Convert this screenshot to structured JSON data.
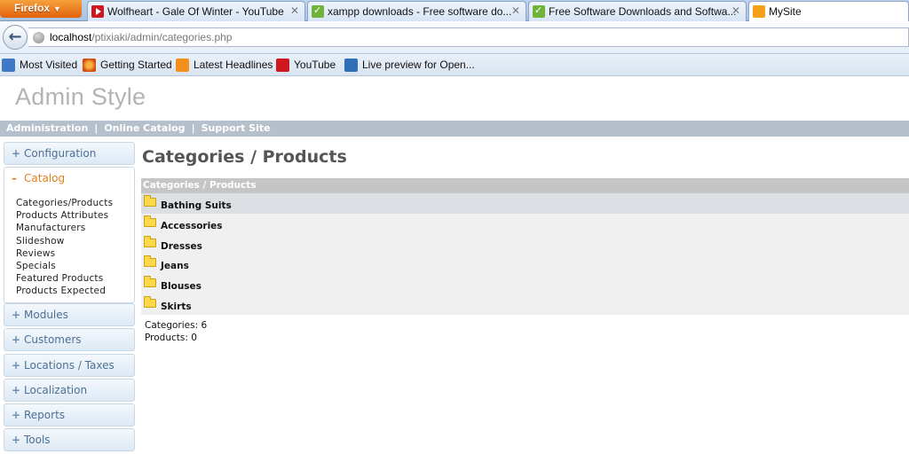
{
  "browser": {
    "app_button": "Firefox",
    "tabs": [
      {
        "title": "Wolfheart - Gale Of Winter - YouTube",
        "icon": "youtube-icon"
      },
      {
        "title": "xampp downloads - Free software do...",
        "icon": "softpedia-icon"
      },
      {
        "title": "Free Software Downloads and Softwa...",
        "icon": "softpedia-icon"
      },
      {
        "title": "MySite",
        "icon": "mysite-icon"
      }
    ],
    "url_host": "localhost",
    "url_path": "/ptixiaki/admin/categories.php",
    "bookmarks": [
      "Most Visited",
      "Getting Started",
      "Latest Headlines",
      "YouTube",
      "Live preview for Open..."
    ]
  },
  "site": {
    "title": "Admin Style",
    "top_links": [
      "Administration",
      "Online Catalog",
      "Support Site"
    ]
  },
  "sidebar": {
    "groups": [
      {
        "sign": "+",
        "label": "Configuration"
      },
      {
        "sign": "–",
        "label": "Catalog"
      },
      {
        "sign": "+",
        "label": "Modules"
      },
      {
        "sign": "+",
        "label": "Customers"
      },
      {
        "sign": "+",
        "label": "Locations / Taxes"
      },
      {
        "sign": "+",
        "label": "Localization"
      },
      {
        "sign": "+",
        "label": "Reports"
      },
      {
        "sign": "+",
        "label": "Tools"
      }
    ],
    "catalog_items": [
      "Categories/Products",
      "Products Attributes",
      "Manufacturers",
      "Slideshow",
      "Reviews",
      "Specials",
      "Featured Products",
      "Products Expected"
    ]
  },
  "main": {
    "title": "Categories / Products",
    "grid_header": "Categories / Products",
    "categories": [
      "Bathing Suits",
      "Accessories",
      "Dresses",
      "Jeans",
      "Blouses",
      "Skirts"
    ],
    "count_categories": "Categories: 6",
    "count_products": "Products: 0"
  }
}
